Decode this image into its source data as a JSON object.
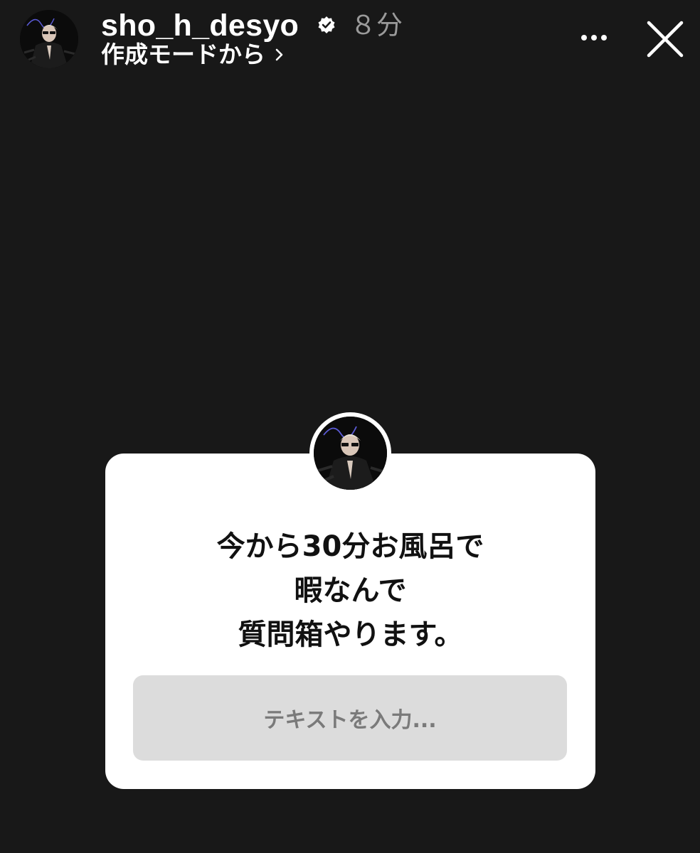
{
  "header": {
    "username": "sho_h_desyo",
    "verified_icon": "verified-badge-icon",
    "time": "８分",
    "subtitle": "作成モードから",
    "more_icon": "more-options-icon",
    "close_icon": "close-icon"
  },
  "question_box": {
    "lines": [
      "今から30分お風呂で",
      "暇なんで",
      "質問箱やります。"
    ],
    "input_placeholder": "テキストを入力..."
  },
  "colors": {
    "background": "#181818",
    "card": "#ffffff",
    "input": "#dcdcdc",
    "time_text": "#9a9a9a"
  }
}
